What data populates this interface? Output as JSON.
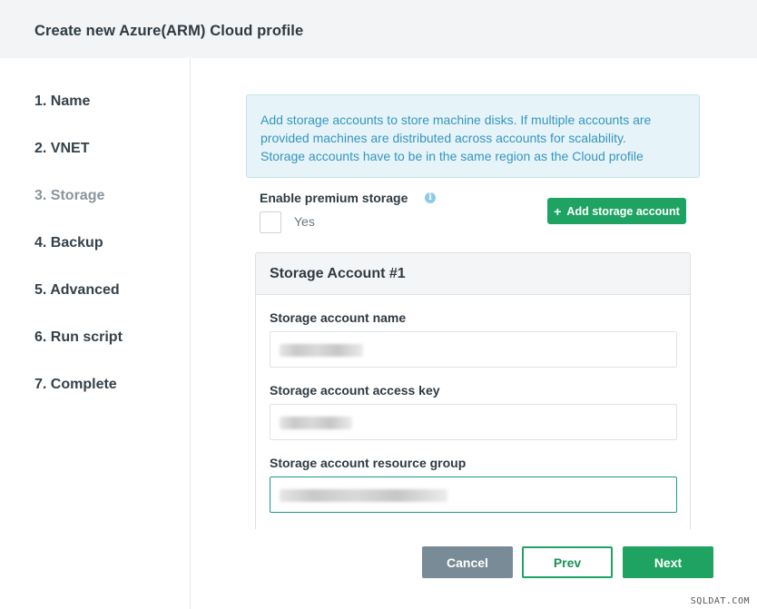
{
  "header": {
    "title": "Create new Azure(ARM) Cloud profile"
  },
  "sidebar": {
    "steps": [
      {
        "label": "1. Name"
      },
      {
        "label": "2. VNET"
      },
      {
        "label": "3. Storage"
      },
      {
        "label": "4. Backup"
      },
      {
        "label": "5. Advanced"
      },
      {
        "label": "6. Run script"
      },
      {
        "label": "7. Complete"
      }
    ],
    "active_step": "3. Storage"
  },
  "info": {
    "line1": "Add storage accounts to store machine disks. If multiple accounts are",
    "line2": "provided machines are distributed across accounts for scalability.",
    "line3": "Storage accounts have to be in the same region as the Cloud profile"
  },
  "premium": {
    "label": "Enable premium storage",
    "info_icon": "i",
    "checkbox_label": "Yes",
    "checked": false
  },
  "add_button": {
    "icon": "+",
    "label": "Add storage account"
  },
  "storage_account": {
    "title": "Storage Account #1",
    "fields": [
      {
        "label": "Storage account name",
        "value_redacted": true
      },
      {
        "label": "Storage account access key",
        "value_redacted": true
      },
      {
        "label": "Storage account resource group",
        "value_redacted": true
      }
    ]
  },
  "footer": {
    "cancel_label": "Cancel",
    "prev_label": "Prev",
    "next_label": "Next"
  },
  "watermark": "SQLDAT.COM",
  "colors": {
    "primary_green": "#1fa363",
    "cancel_gray": "#788b96",
    "info_text": "#3596bd",
    "info_bg": "#e6f3f9",
    "focused_border": "#1e9a8a"
  }
}
